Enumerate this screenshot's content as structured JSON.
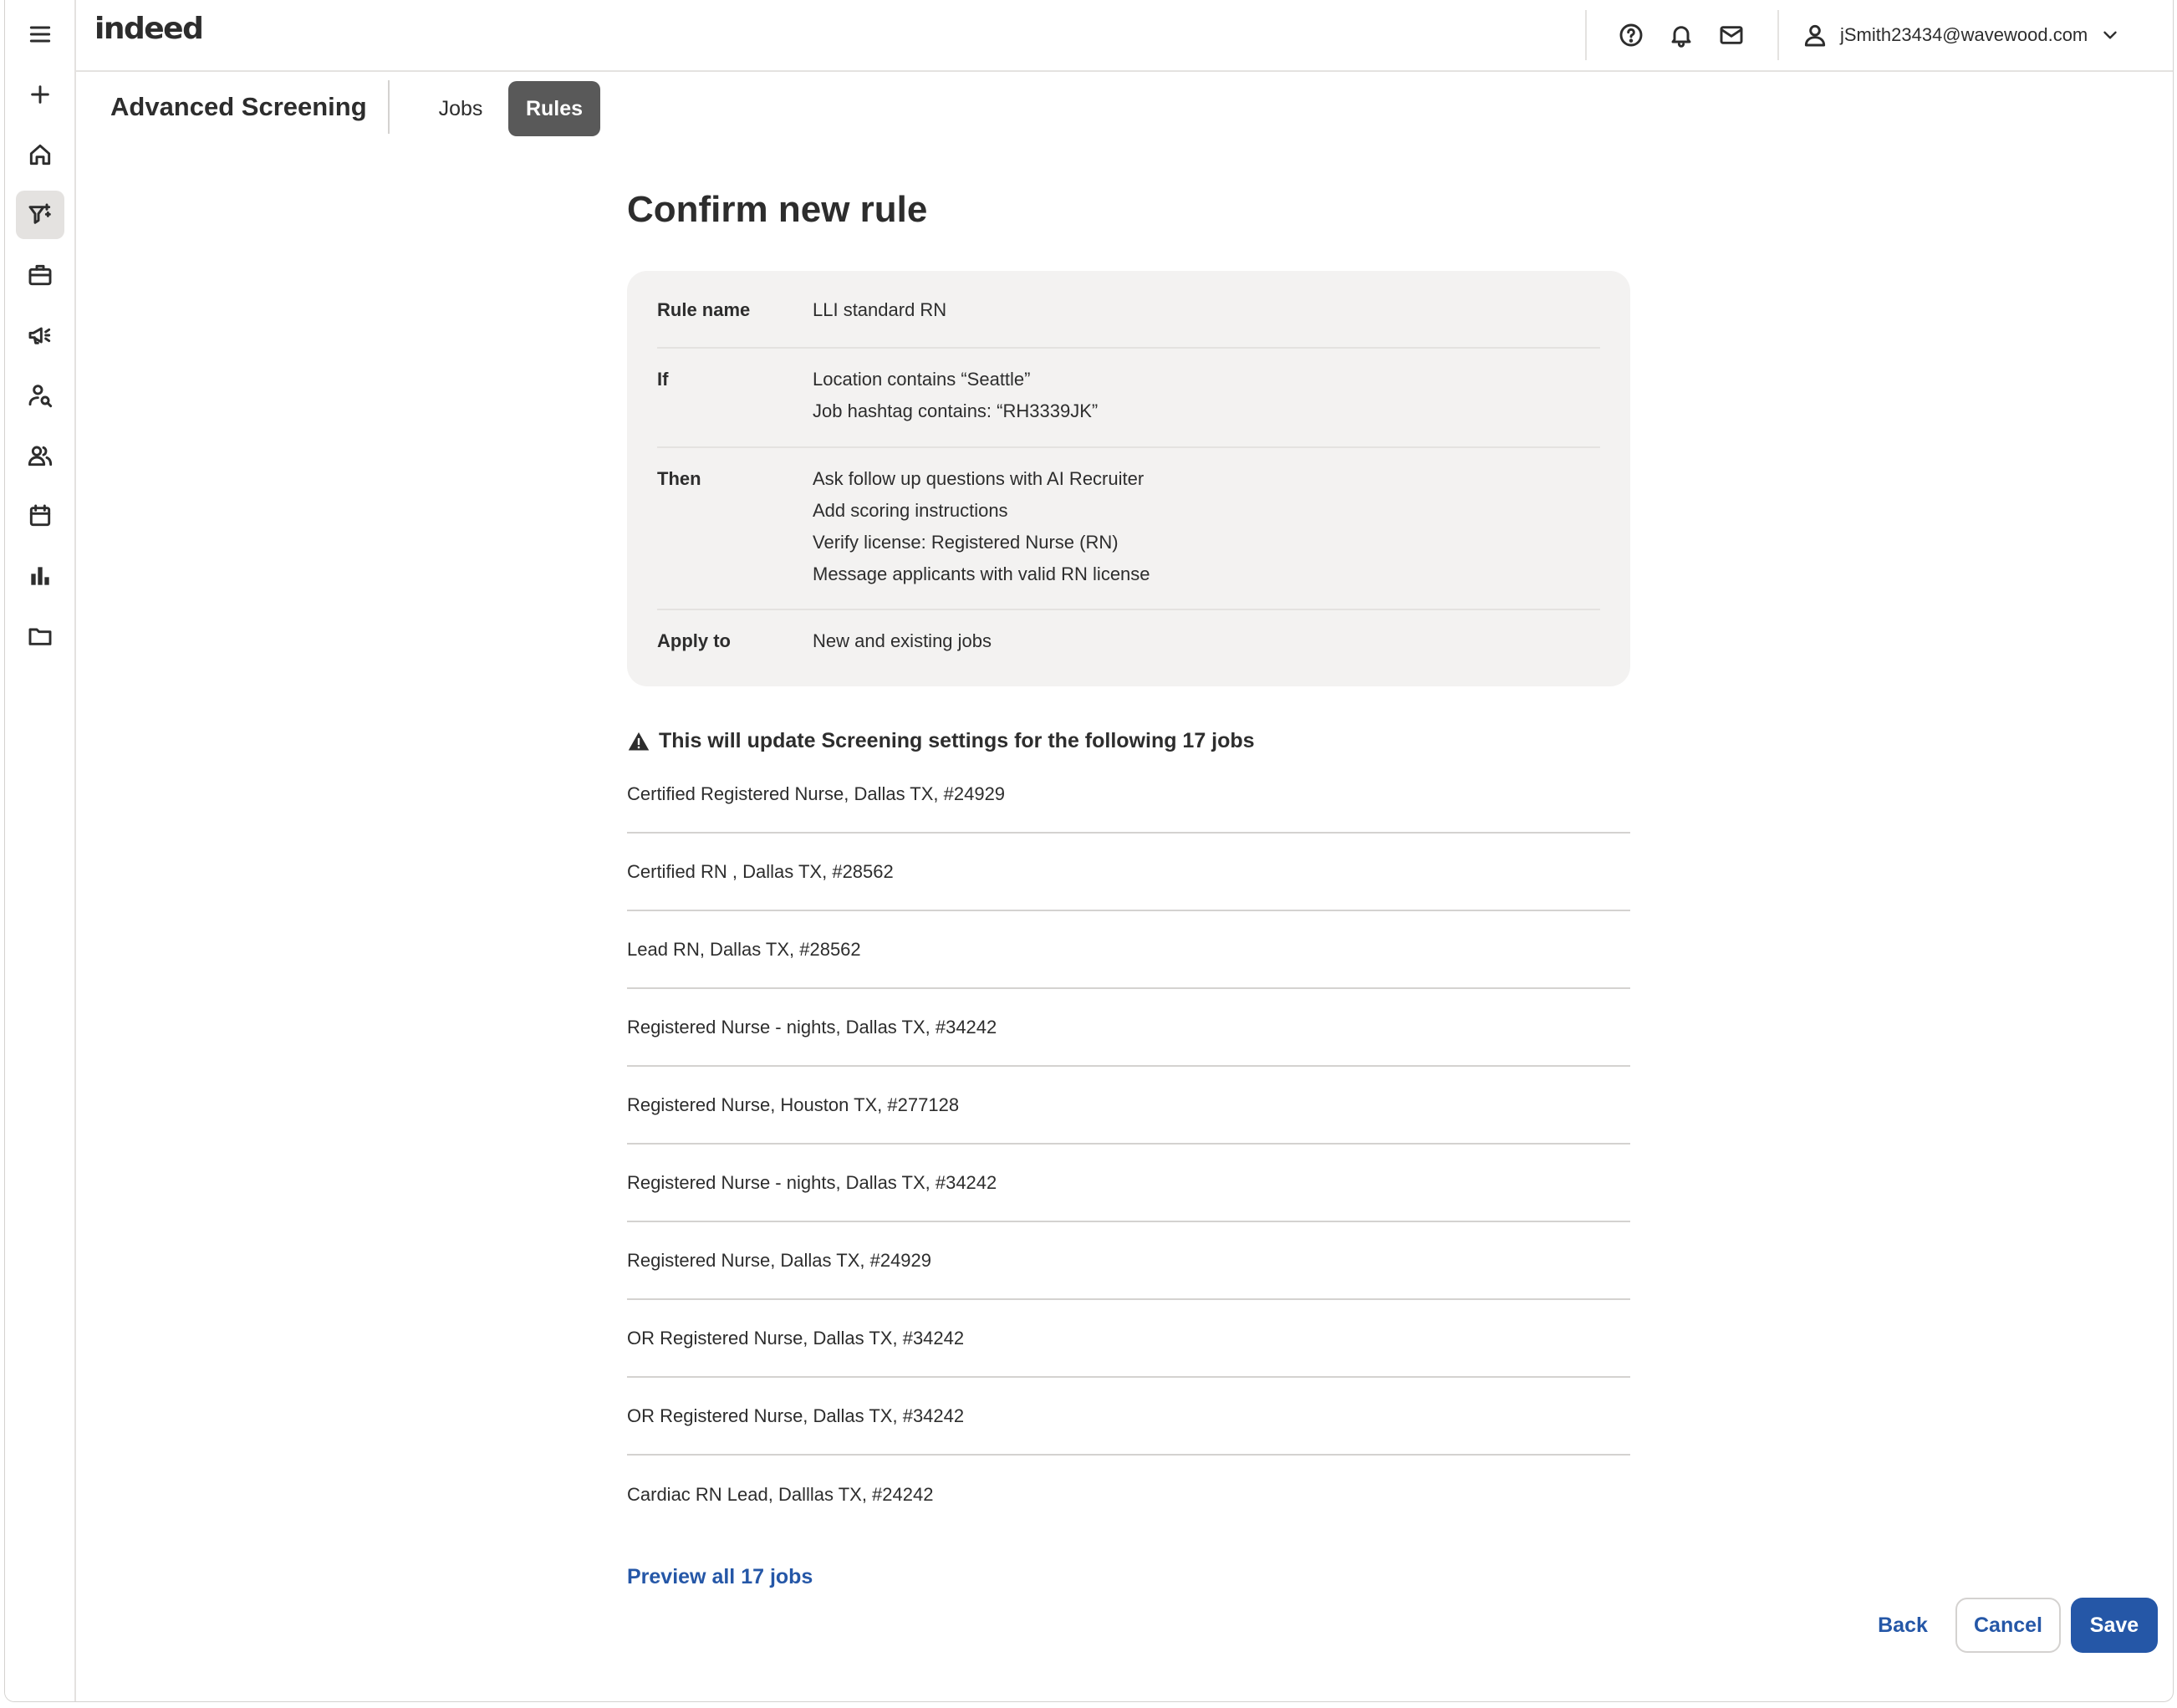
{
  "brand": {
    "logo_text": "indeed"
  },
  "header": {
    "account_email": "jSmith23434@wavewood.com"
  },
  "rail": {
    "items": [
      "menu-icon",
      "add-icon",
      "home-icon",
      "screening-filter-icon",
      "briefcase-icon",
      "megaphone-icon",
      "candidate-search-icon",
      "people-icon",
      "calendar-icon",
      "analytics-icon",
      "folder-icon"
    ]
  },
  "subheader": {
    "title": "Advanced Screening",
    "tabs": [
      {
        "label": "Jobs"
      },
      {
        "label": "Rules"
      }
    ]
  },
  "main": {
    "title": "Confirm new rule",
    "summary": {
      "rule_name": {
        "label": "Rule name",
        "values": [
          "LLI standard RN"
        ]
      },
      "if": {
        "label": "If",
        "values": [
          "Location contains “Seattle”",
          "Job hashtag contains: “RH3339JK”"
        ]
      },
      "then": {
        "label": "Then",
        "values": [
          "Ask follow up questions with AI Recruiter",
          "Add scoring instructions",
          "Verify license: Registered Nurse (RN)",
          "Message applicants with valid RN license"
        ]
      },
      "apply_to": {
        "label": "Apply to",
        "values": [
          "New and existing jobs"
        ]
      }
    },
    "warning": "This will update Screening settings for the following 17 jobs",
    "jobs": [
      "Certified Registered Nurse, Dallas TX, #24929",
      "Certified RN , Dallas TX, #28562",
      "Lead RN, Dallas TX, #28562",
      "Registered Nurse - nights, Dallas TX, #34242",
      "Registered Nurse, Houston TX, #277128",
      "Registered Nurse - nights, Dallas TX, #34242",
      "Registered Nurse, Dallas TX, #24929",
      "OR Registered Nurse, Dallas TX, #34242",
      "OR Registered Nurse, Dallas TX, #34242",
      "Cardiac RN Lead, Dalllas TX, #24242"
    ],
    "preview_link": "Preview all 17 jobs"
  },
  "footer": {
    "back_label": "Back",
    "cancel_label": "Cancel",
    "save_label": "Save"
  },
  "colors": {
    "primary": "#2557a7",
    "text": "#2d2d2d",
    "tab_active_bg": "#595959",
    "panel_bg": "#f3f2f1"
  }
}
